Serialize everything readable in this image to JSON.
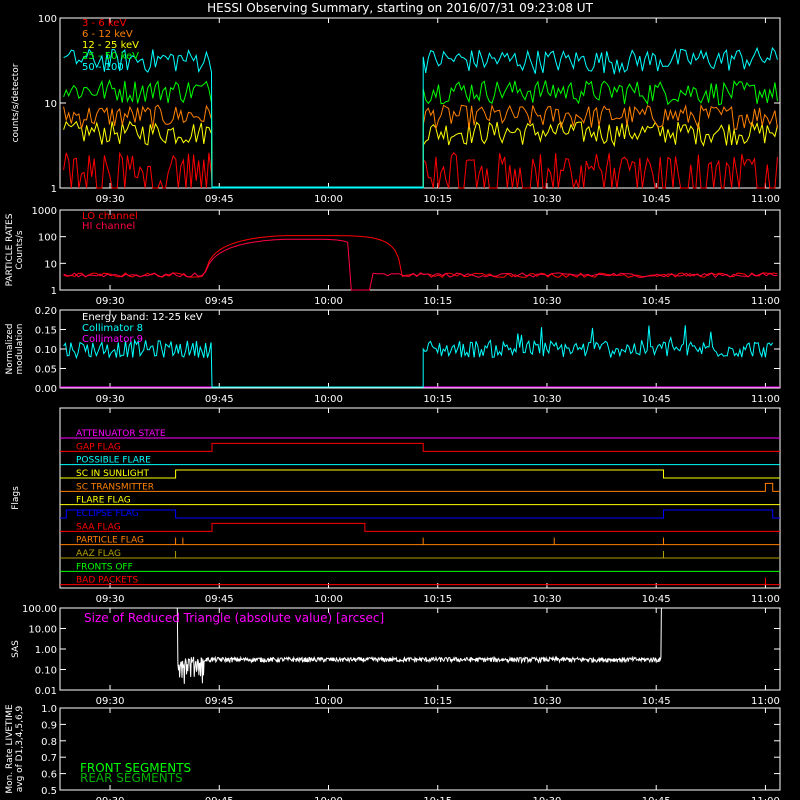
{
  "title": "HESSI Observing Summary, starting on 2016/07/31 09:23:08 UT",
  "time_ticks": [
    "09:30",
    "09:45",
    "10:00",
    "10:15",
    "10:30",
    "10:45",
    "11:00"
  ],
  "colors": {
    "background": "#000000",
    "axes": "#ffffff",
    "red": "#ff0000",
    "orange": "#ff8000",
    "yellow": "#ffff00",
    "green": "#00ff00",
    "cyan": "#00ffff",
    "magenta": "#ff00ff",
    "blue": "#0000ff",
    "olive": "#b0a000",
    "crimson": "#ff0044"
  },
  "chart_data": [
    {
      "id": "count-rates",
      "type": "line",
      "ylabel": "counts/s/detector",
      "yscale": "log",
      "ylim": [
        1,
        100
      ],
      "ytick_labels": [
        "1",
        "10",
        "100"
      ],
      "legend_placement": "top-left",
      "gap": [
        "09:44",
        "10:13"
      ],
      "series": [
        {
          "name": "3 - 6 keV",
          "color": "red",
          "typical_level": 1.6
        },
        {
          "name": "6 - 12 keV",
          "color": "orange",
          "typical_level": 7
        },
        {
          "name": "12 - 25 keV",
          "color": "yellow",
          "typical_level": 4.5
        },
        {
          "name": "25 - 50 keV",
          "color": "green",
          "typical_level": 14
        },
        {
          "name": "50 - 100",
          "color": "cyan",
          "typical_level": 32
        }
      ]
    },
    {
      "id": "particle-rates",
      "type": "line",
      "ylabel": "PARTICLE RATES\nCounts/s",
      "yscale": "log",
      "ylim": [
        1,
        1000
      ],
      "ytick_labels": [
        "1",
        "10",
        "100",
        "1000"
      ],
      "series": [
        {
          "name": "LO channel",
          "color": "red",
          "baseline": 3.5,
          "peak": 110
        },
        {
          "name": "HI channel",
          "color": "crimson",
          "baseline": 3.5,
          "peak": 80
        }
      ]
    },
    {
      "id": "modulation",
      "type": "line",
      "ylabel": "Normalized\nmodulation",
      "ylim": [
        0,
        0.2
      ],
      "ytick_labels": [
        "0.00",
        "0.05",
        "0.10",
        "0.15",
        "0.20"
      ],
      "annotation": "Energy band: 12-25 keV",
      "series": [
        {
          "name": "Collimator 8",
          "color": "cyan",
          "typical_level": 0.1
        },
        {
          "name": "Collimator 9",
          "color": "magenta",
          "typical_level": 0.0
        }
      ]
    },
    {
      "id": "flags",
      "type": "line",
      "ylabel": "Flags",
      "flags": [
        {
          "name": "ATTENUATOR STATE",
          "color": "magenta",
          "segments": []
        },
        {
          "name": "GAP FLAG",
          "color": "red",
          "segments": [
            [
              "09:44",
              "10:13"
            ]
          ]
        },
        {
          "name": "POSSIBLE FLARE",
          "color": "cyan",
          "segments": []
        },
        {
          "name": "SC IN SUNLIGHT",
          "color": "yellow",
          "segments": [
            [
              "09:39",
              "10:46"
            ]
          ]
        },
        {
          "name": "SC TRANSMITTER",
          "color": "orange",
          "segments": [
            [
              "11:00",
              "11:01"
            ]
          ]
        },
        {
          "name": "FLARE FLAG",
          "color": "yellow",
          "segments": []
        },
        {
          "name": "ECLIPSE FLAG",
          "color": "blue",
          "segments": [
            [
              "09:24",
              "09:39"
            ],
            [
              "10:46",
              "11:01"
            ]
          ]
        },
        {
          "name": "SAA FLAG",
          "color": "red",
          "segments": [
            [
              "09:44",
              "10:05"
            ]
          ]
        },
        {
          "name": "PARTICLE FLAG",
          "color": "orange",
          "spikes": [
            "09:39",
            "09:40",
            "10:13",
            "10:31",
            "10:46"
          ]
        },
        {
          "name": "AAZ FLAG",
          "color": "olive",
          "spikes": [
            "09:39",
            "10:46"
          ]
        },
        {
          "name": "FRONTS OFF",
          "color": "green",
          "segments": []
        },
        {
          "name": "BAD PACKETS",
          "color": "red",
          "spikes": [
            "11:00"
          ]
        }
      ]
    },
    {
      "id": "sas",
      "type": "line",
      "ylabel": "SAS",
      "yscale": "log",
      "ylim": [
        0.01,
        100
      ],
      "ytick_labels": [
        "0.01",
        "0.10",
        "1.00",
        "10.00",
        "100.00"
      ],
      "annotation": "Size of Reduced Triangle (absolute value) [arcsec]",
      "series": [
        {
          "name": "SAS triangle",
          "color": "white",
          "range": [
            "09:39",
            "10:46"
          ],
          "typical_level": 0.3
        }
      ]
    },
    {
      "id": "livetime",
      "type": "line",
      "ylabel": "Mon. Rate LIVETIME\navg of D1,3,4,5,6,9",
      "ylim": [
        0.5,
        1.0
      ],
      "ytick_labels": [
        "0.5",
        "0.6",
        "0.7",
        "0.8",
        "0.9",
        "1.0"
      ],
      "series": [
        {
          "name": "FRONT SEGMENTS",
          "color": "green"
        },
        {
          "name": "REAR SEGMENTS",
          "color": "green"
        }
      ]
    }
  ]
}
